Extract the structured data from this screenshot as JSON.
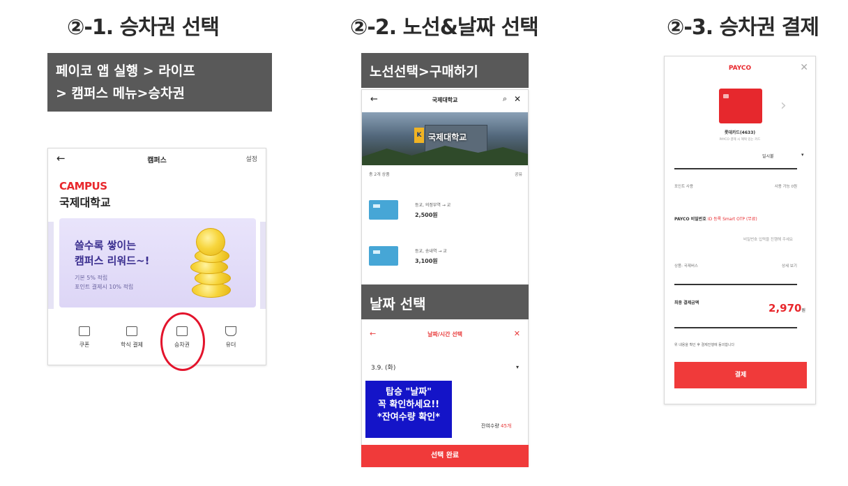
{
  "sections": {
    "s1": {
      "title": "②-1. 승차권 선택",
      "caption": [
        "페이코 앱 실행 > 라이프",
        "> 캠퍼스 메뉴>승차권"
      ]
    },
    "s2": {
      "title": "②-2. 노선&날짜 선택",
      "caption_route": "노선선택>구매하기",
      "caption_date": "날짜 선택"
    },
    "s3": {
      "title": "②-3. 승차권 결제"
    }
  },
  "phone1": {
    "back_icon": "back-arrow-icon",
    "title": "캠퍼스",
    "settings": "설정",
    "brand": "CAMPUS",
    "school": "국제대학교",
    "banner": {
      "line1": "쓸수록 쌓이는",
      "line2": "캠퍼스 리워드~!",
      "line3": "기본 5% 적립",
      "line4": "포인트 결제시 10% 적립"
    },
    "menu": [
      {
        "label": "쿠폰",
        "icon": "coupon-icon"
      },
      {
        "label": "학식 결제",
        "icon": "meal-icon"
      },
      {
        "label": "승차권",
        "icon": "ticket-icon"
      },
      {
        "label": "유더",
        "icon": "cup-icon"
      }
    ]
  },
  "phone2": {
    "title": "국제대학교",
    "hero_name": "국제대학교",
    "hero_emblem": "K",
    "sub_left": "총 2개 상품",
    "sub_right": "공유",
    "tickets": [
      {
        "name": "등교, 의정부역 → 교",
        "price": "2,500원"
      },
      {
        "name": "등교, 송내역 → 교",
        "price": "3,100원"
      }
    ],
    "date_header": "날짜/시간 선택",
    "date_value": "3.9. (화)",
    "remaining_label": "잔여수량",
    "remaining_value": "45개",
    "note": [
      "탑승 \"날짜\"",
      "꼭 확인하세요!!",
      "*잔여수량 확인*"
    ],
    "button": "선택 완료"
  },
  "phone3": {
    "brand": "PAYCO",
    "card_name": "롯데카드(4633)",
    "card_sub": "PAYCO 결제 시 혜택 있는 카드",
    "installment": "일시불",
    "point_row_left": "포인트 사용",
    "point_row_right": "사용 가능 0원",
    "pw_label": "PAYCO 비밀번호",
    "pw_hint": "ID 등록 Smart OTP (무료)",
    "pw_placeholder": "비밀번호 입력을 진행해 주세요",
    "info_row_left": "상품: 국제버스",
    "info_row_right": "상세 보기",
    "total_label": "최종 결제금액",
    "total_amount": "2,970",
    "total_unit": "원",
    "agree": "위 내용을 확인 후 결제진행에 동의합니다",
    "button": "결제"
  },
  "colors": {
    "accent_red": "#f03a3a",
    "brand_red": "#e8282d",
    "dark_box": "#595959",
    "note_blue": "#1414c8",
    "circle_red": "#e3142c"
  }
}
